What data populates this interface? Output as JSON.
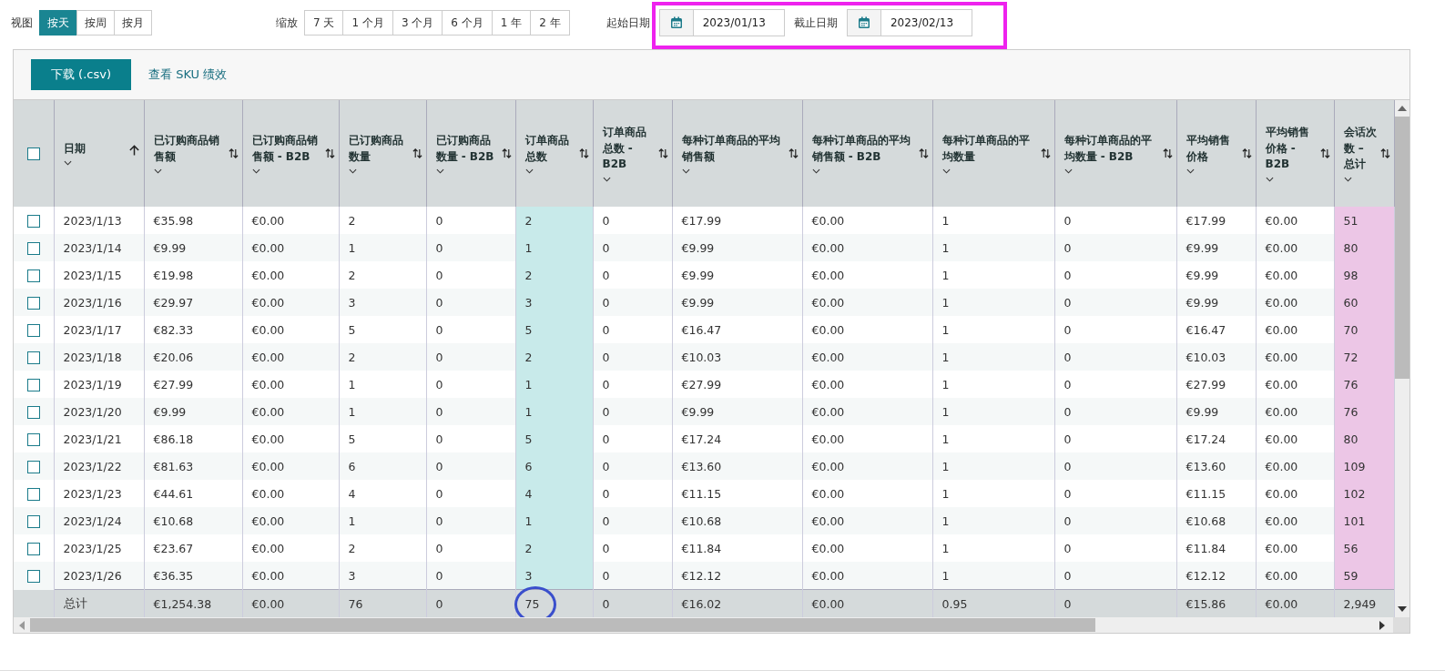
{
  "toolbar": {
    "view_label": "视图",
    "views": [
      {
        "label": "按天",
        "selected": true
      },
      {
        "label": "按周",
        "selected": false
      },
      {
        "label": "按月",
        "selected": false
      }
    ],
    "zoom_label": "缩放",
    "zooms": [
      {
        "label": "7 天",
        "selected": false
      },
      {
        "label": "1 个月",
        "selected": false
      },
      {
        "label": "3 个月",
        "selected": false
      },
      {
        "label": "6 个月",
        "selected": false
      },
      {
        "label": "1 年",
        "selected": false
      },
      {
        "label": "2 年",
        "selected": false
      }
    ],
    "start_label": "起始日期",
    "start_date": "2023/01/13",
    "end_label": "截止日期",
    "end_date": "2023/02/13",
    "dates_highlighted": true
  },
  "actions": {
    "download": "下载 (.csv)",
    "link": "查看 SKU 绩效"
  },
  "table": {
    "select_all_checked": false,
    "columns": [
      {
        "label": "日期",
        "sorted": true
      },
      {
        "label": "已订购商品销售额",
        "sorted": false
      },
      {
        "label": "已订购商品销售额 - B2B",
        "sorted": false
      },
      {
        "label": "已订购商品数量",
        "sorted": false
      },
      {
        "label": "已订购商品数量 - B2B",
        "sorted": false
      },
      {
        "label": "订单商品总数",
        "sorted": false,
        "color": "#c8eaea"
      },
      {
        "label": "订单商品总数 - B2B",
        "sorted": false
      },
      {
        "label": "每种订单商品的平均销售额",
        "sorted": false
      },
      {
        "label": "每种订单商品的平均销售额 - B2B",
        "sorted": false
      },
      {
        "label": "每种订单商品的平均数量",
        "sorted": false
      },
      {
        "label": "每种订单商品的平均数量 - B2B",
        "sorted": false
      },
      {
        "label": "平均销售价格",
        "sorted": false
      },
      {
        "label": "平均销售价格 - B2B",
        "sorted": false
      },
      {
        "label": "会话次数 – 总计",
        "sorted": false,
        "color": "#ecc6e6"
      }
    ],
    "rows": [
      {
        "checked": false,
        "cells": [
          "2023/1/13",
          "€35.98",
          "€0.00",
          "2",
          "0",
          "2",
          "0",
          "€17.99",
          "€0.00",
          "1",
          "0",
          "€17.99",
          "€0.00",
          "51"
        ]
      },
      {
        "checked": false,
        "cells": [
          "2023/1/14",
          "€9.99",
          "€0.00",
          "1",
          "0",
          "1",
          "0",
          "€9.99",
          "€0.00",
          "1",
          "0",
          "€9.99",
          "€0.00",
          "80"
        ]
      },
      {
        "checked": false,
        "cells": [
          "2023/1/15",
          "€19.98",
          "€0.00",
          "2",
          "0",
          "2",
          "0",
          "€9.99",
          "€0.00",
          "1",
          "0",
          "€9.99",
          "€0.00",
          "98"
        ]
      },
      {
        "checked": false,
        "cells": [
          "2023/1/16",
          "€29.97",
          "€0.00",
          "3",
          "0",
          "3",
          "0",
          "€9.99",
          "€0.00",
          "1",
          "0",
          "€9.99",
          "€0.00",
          "60"
        ]
      },
      {
        "checked": false,
        "cells": [
          "2023/1/17",
          "€82.33",
          "€0.00",
          "5",
          "0",
          "5",
          "0",
          "€16.47",
          "€0.00",
          "1",
          "0",
          "€16.47",
          "€0.00",
          "70"
        ]
      },
      {
        "checked": false,
        "cells": [
          "2023/1/18",
          "€20.06",
          "€0.00",
          "2",
          "0",
          "2",
          "0",
          "€10.03",
          "€0.00",
          "1",
          "0",
          "€10.03",
          "€0.00",
          "72"
        ]
      },
      {
        "checked": false,
        "cells": [
          "2023/1/19",
          "€27.99",
          "€0.00",
          "1",
          "0",
          "1",
          "0",
          "€27.99",
          "€0.00",
          "1",
          "0",
          "€27.99",
          "€0.00",
          "76"
        ]
      },
      {
        "checked": false,
        "cells": [
          "2023/1/20",
          "€9.99",
          "€0.00",
          "1",
          "0",
          "1",
          "0",
          "€9.99",
          "€0.00",
          "1",
          "0",
          "€9.99",
          "€0.00",
          "76"
        ]
      },
      {
        "checked": false,
        "cells": [
          "2023/1/21",
          "€86.18",
          "€0.00",
          "5",
          "0",
          "5",
          "0",
          "€17.24",
          "€0.00",
          "1",
          "0",
          "€17.24",
          "€0.00",
          "80"
        ]
      },
      {
        "checked": false,
        "cells": [
          "2023/1/22",
          "€81.63",
          "€0.00",
          "6",
          "0",
          "6",
          "0",
          "€13.60",
          "€0.00",
          "1",
          "0",
          "€13.60",
          "€0.00",
          "109"
        ]
      },
      {
        "checked": false,
        "cells": [
          "2023/1/23",
          "€44.61",
          "€0.00",
          "4",
          "0",
          "4",
          "0",
          "€11.15",
          "€0.00",
          "1",
          "0",
          "€11.15",
          "€0.00",
          "102"
        ]
      },
      {
        "checked": false,
        "cells": [
          "2023/1/24",
          "€10.68",
          "€0.00",
          "1",
          "0",
          "1",
          "0",
          "€10.68",
          "€0.00",
          "1",
          "0",
          "€10.68",
          "€0.00",
          "101"
        ]
      },
      {
        "checked": false,
        "cells": [
          "2023/1/25",
          "€23.67",
          "€0.00",
          "2",
          "0",
          "2",
          "0",
          "€11.84",
          "€0.00",
          "1",
          "0",
          "€11.84",
          "€0.00",
          "56"
        ]
      },
      {
        "checked": false,
        "cells": [
          "2023/1/26",
          "€36.35",
          "€0.00",
          "3",
          "0",
          "3",
          "0",
          "€12.12",
          "€0.00",
          "1",
          "0",
          "€12.12",
          "€0.00",
          "59"
        ]
      }
    ],
    "totals": [
      {
        "text": "总计",
        "circled": false
      },
      {
        "text": "€1,254.38",
        "circled": false
      },
      {
        "text": "€0.00",
        "circled": false
      },
      {
        "text": "76",
        "circled": false
      },
      {
        "text": "0",
        "circled": false
      },
      {
        "text": "75",
        "circled": true
      },
      {
        "text": "0",
        "circled": false
      },
      {
        "text": "€16.02",
        "circled": false
      },
      {
        "text": "€0.00",
        "circled": false
      },
      {
        "text": "0.95",
        "circled": false
      },
      {
        "text": "0",
        "circled": false
      },
      {
        "text": "€15.86",
        "circled": false
      },
      {
        "text": "€0.00",
        "circled": false
      },
      {
        "text": "2,949",
        "circled": false
      }
    ]
  }
}
